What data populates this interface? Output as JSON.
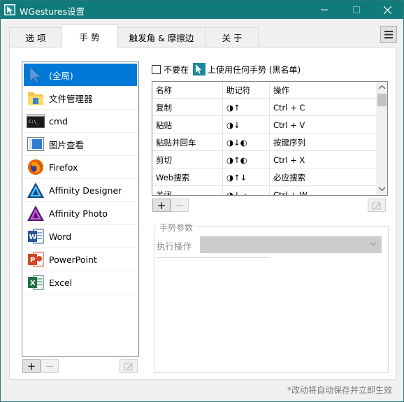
{
  "window": {
    "title": "WGestures设置"
  },
  "tabs": [
    {
      "label": "选 项"
    },
    {
      "label": "手 势"
    },
    {
      "label": "触发角 & 摩擦边"
    },
    {
      "label": "关 于"
    }
  ],
  "active_tab": 1,
  "apps": [
    {
      "label": "(全局)",
      "icon": "cursor-icon",
      "selected": true
    },
    {
      "label": "文件管理器",
      "icon": "folder-icon"
    },
    {
      "label": "cmd",
      "icon": "cmd-icon"
    },
    {
      "label": "图片查看",
      "icon": "image-viewer-icon"
    },
    {
      "label": "Firefox",
      "icon": "firefox-icon"
    },
    {
      "label": "Affinity Designer",
      "icon": "affinity-designer-icon"
    },
    {
      "label": "Affinity Photo",
      "icon": "affinity-photo-icon"
    },
    {
      "label": "Word",
      "icon": "word-icon"
    },
    {
      "label": "PowerPoint",
      "icon": "powerpoint-icon"
    },
    {
      "label": "Excel",
      "icon": "excel-icon"
    }
  ],
  "app_buttons": {
    "add": "+",
    "remove": "−"
  },
  "blacklist": {
    "prefix": "不要在",
    "suffix": "上使用任何手势 (黑名单)",
    "checked": false
  },
  "gesture_table": {
    "headers": [
      "名称",
      "助记符",
      "操作"
    ],
    "rows": [
      [
        "复制",
        "◑↑",
        "Ctrl + C"
      ],
      [
        "粘贴",
        "◑↓",
        "Ctrl + V"
      ],
      [
        "粘贴并回车",
        "◑↓◐",
        "按键序列"
      ],
      [
        "剪切",
        "◑↑◐",
        "Ctrl + X"
      ],
      [
        "Web搜索",
        "◑↑↓",
        "必应搜索"
      ],
      [
        "关闭",
        "◑↓→",
        "Ctrl + W"
      ]
    ]
  },
  "gesture_buttons": {
    "add": "+",
    "remove": "−"
  },
  "gesture_params": {
    "title": "手势参数",
    "exec_label": "执行操作",
    "exec_value": ""
  },
  "footer": {
    "note": "*改动将自动保存并立即生效"
  },
  "colors": {
    "titlebar": "#117a7a",
    "selection": "#0078d7"
  }
}
